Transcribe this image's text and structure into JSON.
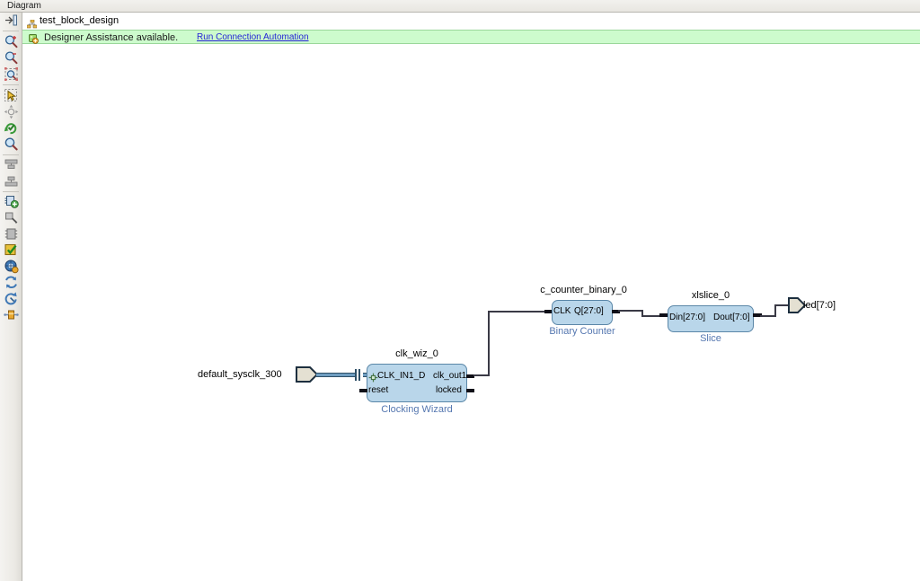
{
  "window": {
    "title": "Diagram"
  },
  "design_tab": {
    "name": "test_block_design",
    "hierarchy_icon": "hierarchy-icon",
    "collapse_icon": "collapse-panel-icon"
  },
  "assistance_banner": {
    "icon": "designer-assistance-icon",
    "message": "Designer Assistance available.",
    "link_label": "Run Connection Automation"
  },
  "toolbar": {
    "items": [
      {
        "name": "collapse-panel-icon",
        "tip": "Collapse panel"
      },
      {
        "name": "zoom-in-icon",
        "tip": "Zoom In"
      },
      {
        "name": "zoom-out-icon",
        "tip": "Zoom Out"
      },
      {
        "name": "zoom-fit-icon",
        "tip": "Zoom Fit"
      },
      {
        "name": "select-area-icon",
        "tip": "Select Area"
      },
      {
        "name": "pan-icon",
        "tip": "Pan"
      },
      {
        "name": "regenerate-layout-icon",
        "tip": "Regenerate Layout"
      },
      {
        "name": "search-icon",
        "tip": "Search"
      },
      {
        "name": "align-top-icon",
        "tip": "Align"
      },
      {
        "name": "align-bottom-icon",
        "tip": "Align"
      },
      {
        "name": "add-ip-icon",
        "tip": "Add IP"
      },
      {
        "name": "add-module-icon",
        "tip": "Add Module"
      },
      {
        "name": "hierarchy-block-icon",
        "tip": "Create Hierarchy"
      },
      {
        "name": "validate-design-icon",
        "tip": "Validate Design"
      },
      {
        "name": "address-editor-icon",
        "tip": "Address Editor"
      },
      {
        "name": "refresh-icon",
        "tip": "Refresh"
      },
      {
        "name": "run-automation-icon",
        "tip": "Run Automation"
      },
      {
        "name": "optimize-routing-icon",
        "tip": "Optimize Routing"
      }
    ]
  },
  "diagram": {
    "external_ports": [
      {
        "name": "default_sysclk_300",
        "direction": "input",
        "type": "bus"
      },
      {
        "name": "led[7:0]",
        "direction": "output",
        "type": "wire"
      }
    ],
    "blocks": [
      {
        "id": "clk_wiz_0",
        "instance_name": "clk_wiz_0",
        "type_name": "Clocking Wizard",
        "inputs": [
          "CLK_IN1_D",
          "reset"
        ],
        "outputs": [
          "clk_out1",
          "locked"
        ],
        "has_diffclk_icon": true
      },
      {
        "id": "c_counter_binary_0",
        "instance_name": "c_counter_binary_0",
        "type_name": "Binary Counter",
        "inputs": [
          "CLK"
        ],
        "outputs": [
          "Q[27:0]"
        ],
        "has_diffclk_icon": false
      },
      {
        "id": "xlslice_0",
        "instance_name": "xlslice_0",
        "type_name": "Slice",
        "inputs": [
          "Din[27:0]"
        ],
        "outputs": [
          "Dout[7:0]"
        ],
        "has_diffclk_icon": false
      }
    ],
    "connections": [
      {
        "from": "default_sysclk_300",
        "to": "clk_wiz_0.CLK_IN1_D"
      },
      {
        "from": "clk_wiz_0.clk_out1",
        "to": "c_counter_binary_0.CLK"
      },
      {
        "from": "c_counter_binary_0.Q[27:0]",
        "to": "xlslice_0.Din[27:0]"
      },
      {
        "from": "xlslice_0.Dout[7:0]",
        "to": "led[7:0]"
      }
    ]
  },
  "colors": {
    "block_fill": "#b9d6ea",
    "block_border": "#5b87a8",
    "type_label": "#5577b0",
    "banner_bg": "#cdfbcd",
    "link": "#2525d6",
    "bus_wire": "#6e9dc0",
    "wire": "#3a3a46"
  }
}
